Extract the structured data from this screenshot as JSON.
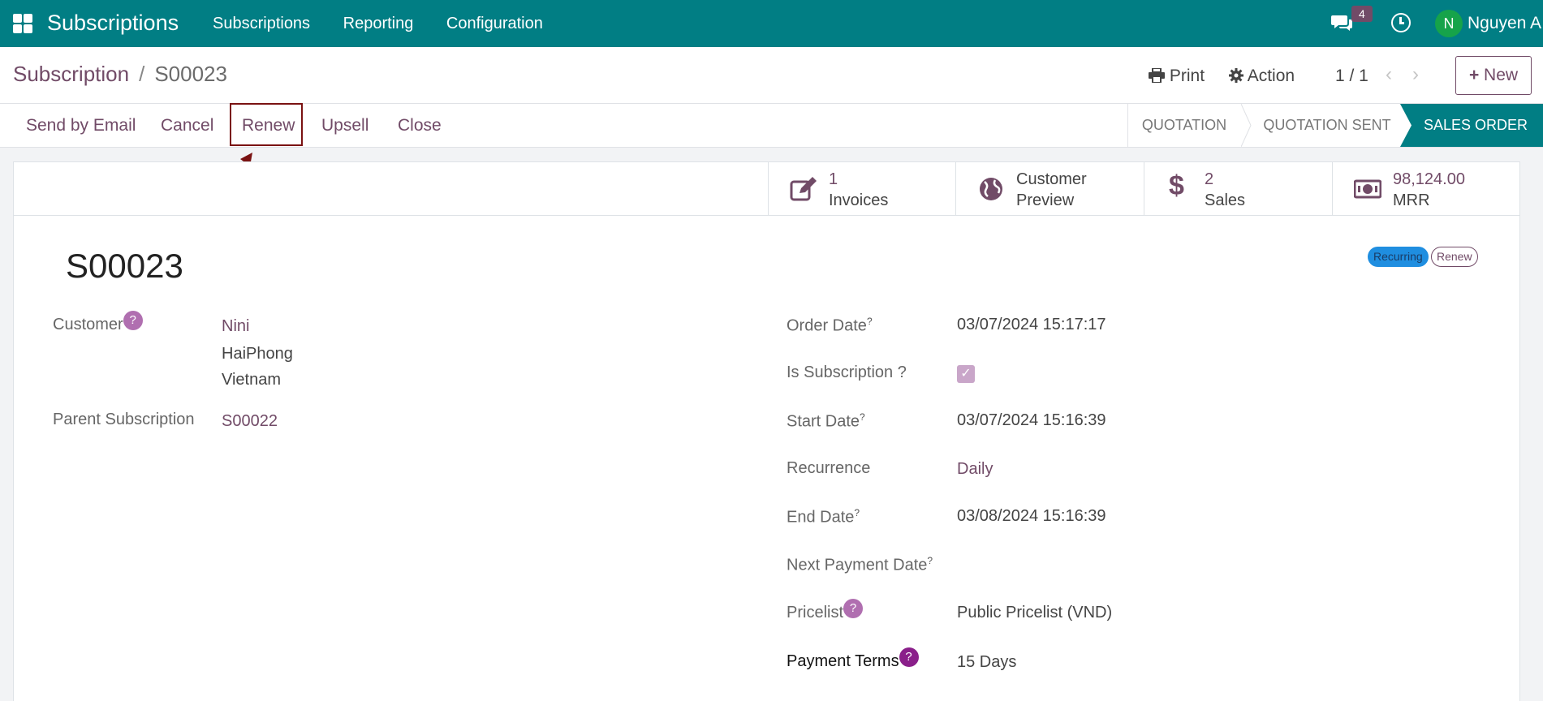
{
  "topnav": {
    "app_title": "Subscriptions",
    "menu": [
      "Subscriptions",
      "Reporting",
      "Configuration"
    ],
    "message_count": "4",
    "avatar_initial": "N",
    "username": "Nguyen A",
    "bg_color": "#017e84"
  },
  "control": {
    "breadcrumb_parent": "Subscription",
    "breadcrumb_sep": "/",
    "breadcrumb_current": "S00023",
    "print_label": "Print",
    "action_label": "Action",
    "pager": "1 / 1",
    "new_label": "New"
  },
  "statusbar": {
    "buttons": [
      "Send by Email",
      "Cancel",
      "Renew",
      "Upsell",
      "Close"
    ],
    "stages": [
      "QUOTATION",
      "QUOTATION SENT",
      "SALES ORDER"
    ],
    "active_stage": "SALES ORDER"
  },
  "smart_buttons": [
    {
      "value": "1",
      "label": "Invoices",
      "icon": "edit-icon"
    },
    {
      "value": "Customer",
      "label": "Preview",
      "icon": "globe-icon"
    },
    {
      "value": "2",
      "label": "Sales",
      "icon": "dollar-icon"
    },
    {
      "value": "98,124.00",
      "label": "MRR",
      "icon": "money-icon"
    }
  ],
  "record": {
    "name": "S00023",
    "tags": [
      "Recurring",
      "Renew"
    ]
  },
  "left_fields": {
    "customer_label": "Customer",
    "customer_name": "Nini",
    "customer_city": "HaiPhong",
    "customer_country": "Vietnam",
    "parent_label": "Parent Subscription",
    "parent_value": "S00022"
  },
  "right_fields": {
    "order_date_label": "Order Date",
    "order_date": "03/07/2024 15:17:17",
    "is_subscription_label": "Is Subscription ?",
    "start_date_label": "Start Date",
    "start_date": "03/07/2024 15:16:39",
    "recurrence_label": "Recurrence",
    "recurrence": "Daily",
    "end_date_label": "End Date",
    "end_date": "03/08/2024 15:16:39",
    "next_payment_label": "Next Payment Date",
    "pricelist_label": "Pricelist",
    "pricelist": "Public Pricelist (VND)",
    "payment_terms_label": "Payment Terms",
    "payment_terms": "15 Days"
  },
  "help_marker": "?"
}
